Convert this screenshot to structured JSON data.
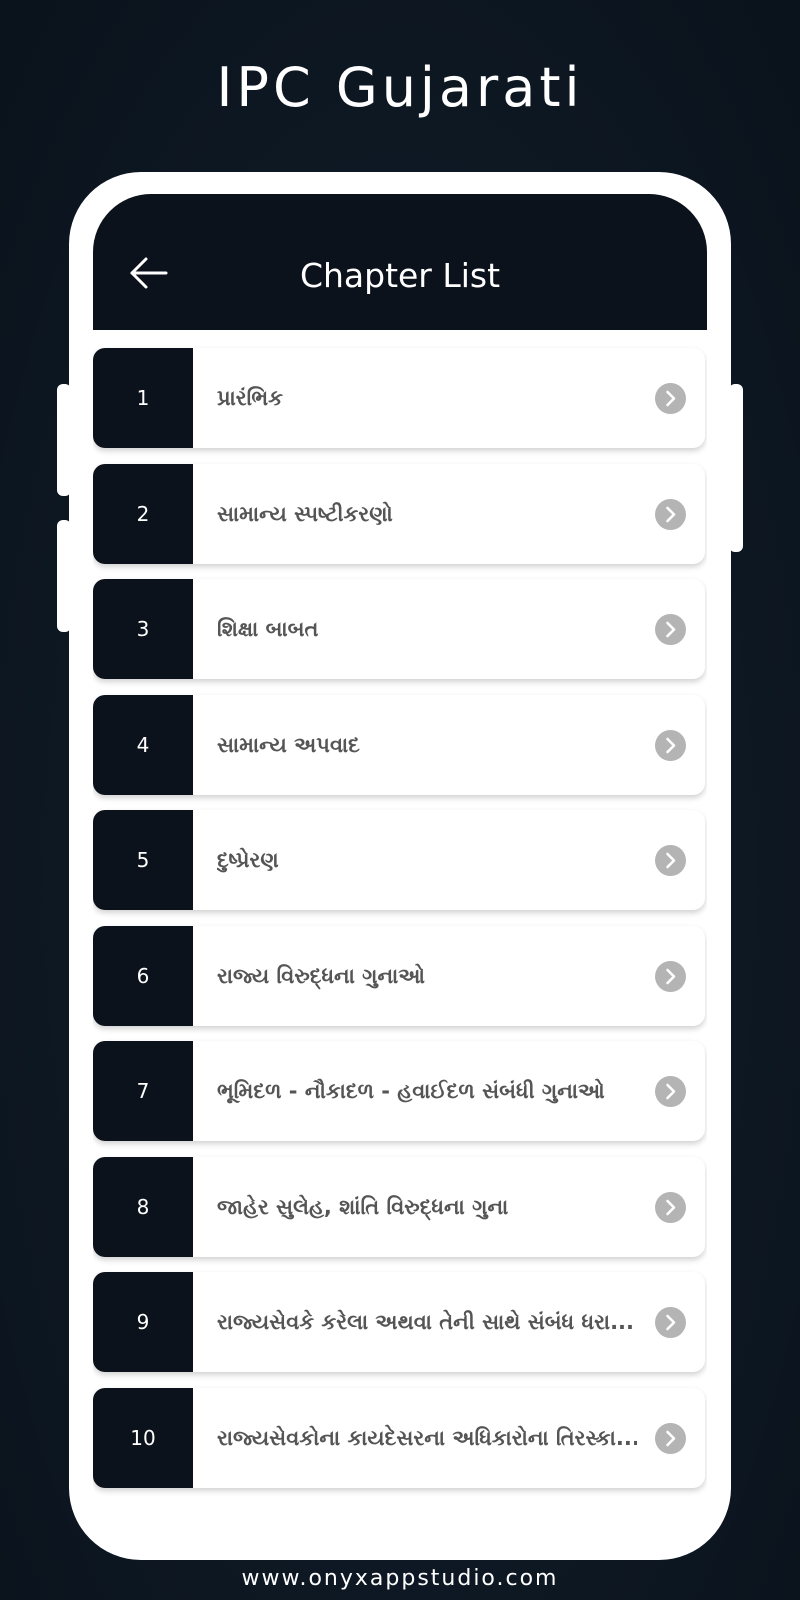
{
  "promo": {
    "title": "IPC Gujarati",
    "footer_url": "www.onyxappstudio.com"
  },
  "header": {
    "back_icon": "arrow-left-icon",
    "title": "Chapter List"
  },
  "chapters": [
    {
      "number": "1",
      "title": "પ્રારંભિક"
    },
    {
      "number": "2",
      "title": "સામાન્ય સ્પષ્ટીકરણો"
    },
    {
      "number": "3",
      "title": "શિક્ષા બાબત"
    },
    {
      "number": "4",
      "title": "સામાન્ય અપવાદ"
    },
    {
      "number": "5",
      "title": "દુષ્પ્રેરણ"
    },
    {
      "number": "6",
      "title": "રાજ્ય વિરુદ્ધના ગુનાઓ"
    },
    {
      "number": "7",
      "title": "ભૂમિદળ - નૌકાદળ - હવાઈદળ સંબંધી ગુનાઓ"
    },
    {
      "number": "8",
      "title": "જાહેર સુલેહ, શાંતિ વિરુદ્ધના ગુના"
    },
    {
      "number": "9",
      "title": "રાજ્યસેવકે કરેલા અથવા તેની સાથે સંબંધ ધરા..."
    },
    {
      "number": "10",
      "title": "રાજ્યસેવકોના કાયદેસરના અધિકારોના તિરસ્કા..."
    }
  ],
  "colors": {
    "header_bg": "#0c121b",
    "arrow_circle": "#b4b4b4",
    "label_text": "#555555"
  },
  "icons": {
    "row_arrow": "chevron-right-circle-icon"
  }
}
